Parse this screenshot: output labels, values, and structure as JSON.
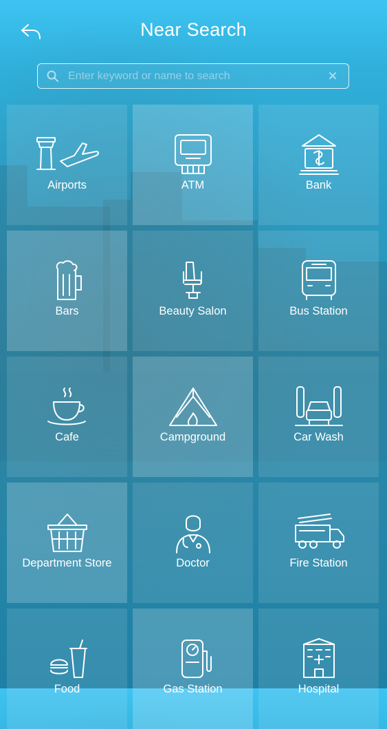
{
  "header": {
    "title": "Near Search",
    "back_icon": "back-arrow-icon"
  },
  "search": {
    "placeholder": "Enter keyword or name to search",
    "value": "",
    "icon": "search-icon",
    "clear_icon": "clear-icon"
  },
  "colors": {
    "background_top": "#3ec3f2",
    "background_bottom": "#1f87ad",
    "text": "#ffffff"
  },
  "categories": [
    {
      "label": "Airports",
      "icon": "airport-icon"
    },
    {
      "label": "ATM",
      "icon": "atm-icon"
    },
    {
      "label": "Bank",
      "icon": "bank-icon"
    },
    {
      "label": "Bars",
      "icon": "beer-icon"
    },
    {
      "label": "Beauty Salon",
      "icon": "salon-chair-icon"
    },
    {
      "label": "Bus Station",
      "icon": "bus-icon"
    },
    {
      "label": "Cafe",
      "icon": "coffee-cup-icon"
    },
    {
      "label": "Campground",
      "icon": "tent-icon"
    },
    {
      "label": "Car Wash",
      "icon": "car-wash-icon"
    },
    {
      "label": "Department Store",
      "icon": "basket-icon"
    },
    {
      "label": "Doctor",
      "icon": "doctor-icon"
    },
    {
      "label": "Fire Station",
      "icon": "fire-truck-icon"
    },
    {
      "label": "Food",
      "icon": "fast-food-icon"
    },
    {
      "label": "Gas Station",
      "icon": "gas-pump-icon"
    },
    {
      "label": "Hospital",
      "icon": "hospital-icon"
    }
  ]
}
